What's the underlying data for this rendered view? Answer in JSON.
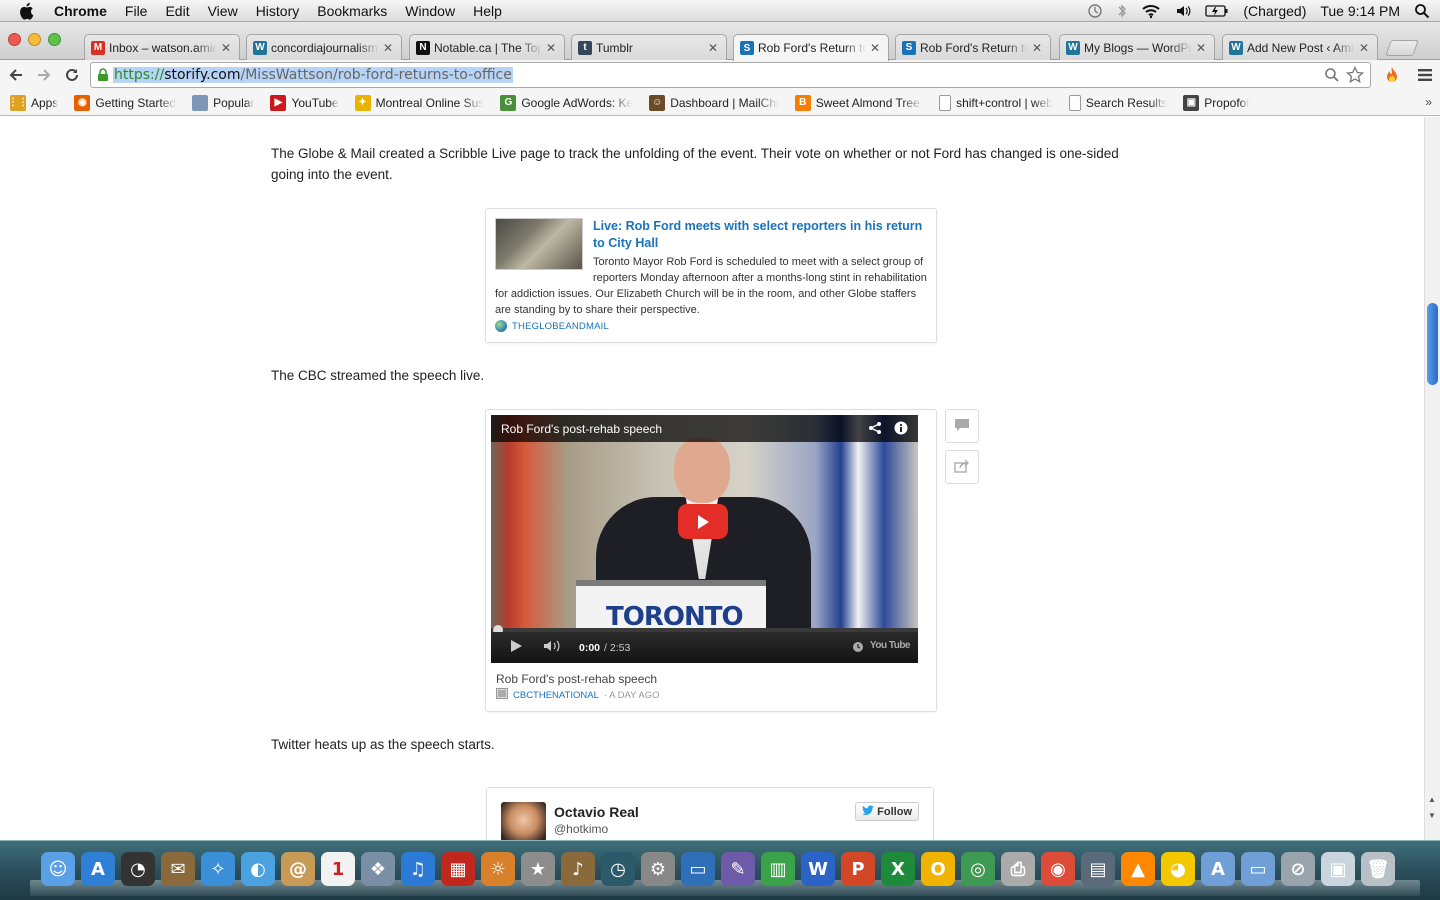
{
  "menubar": {
    "app_name": "Chrome",
    "menus": [
      "File",
      "Edit",
      "View",
      "History",
      "Bookmarks",
      "Window",
      "Help"
    ],
    "battery_status": "(Charged)",
    "clock": "Tue 9:14 PM"
  },
  "tabs": [
    {
      "title": "Inbox – watson.amie",
      "icon": "gmail-icon",
      "color": "#d93025",
      "glyph": "M"
    },
    {
      "title": "concordiajournalism",
      "icon": "wordpress-icon",
      "color": "#21759b",
      "glyph": "W"
    },
    {
      "title": "Notable.ca | The Top",
      "icon": "notable-icon",
      "color": "#111111",
      "glyph": "N"
    },
    {
      "title": "Tumblr",
      "icon": "tumblr-icon",
      "color": "#35465c",
      "glyph": "t"
    },
    {
      "title": "Rob Ford's Return to",
      "icon": "storify-icon",
      "color": "#1a73b8",
      "glyph": "S",
      "active": true
    },
    {
      "title": "Rob Ford's Return to",
      "icon": "storify-icon",
      "color": "#1a73b8",
      "glyph": "S"
    },
    {
      "title": "My Blogs — WordPre",
      "icon": "wordpress-icon",
      "color": "#21759b",
      "glyph": "W"
    },
    {
      "title": "Add New Post ‹ Amie",
      "icon": "wordpress-icon",
      "color": "#21759b",
      "glyph": "W"
    }
  ],
  "address": {
    "scheme": "https://",
    "host": "storify.com",
    "path": "/MissWattson/rob-ford-returns-to-office"
  },
  "bookmarks": [
    {
      "title": "Apps",
      "icon": "apps-grid-icon",
      "color": "#e0a020",
      "glyph": "⋮⋮"
    },
    {
      "title": "Getting Started",
      "icon": "firefox-icon",
      "color": "#e66000",
      "glyph": "◉"
    },
    {
      "title": "Popular",
      "icon": "folder-icon",
      "color": "#7d96b8",
      "glyph": ""
    },
    {
      "title": "YouTube",
      "icon": "youtube-icon",
      "color": "#cc181e",
      "glyph": "▶"
    },
    {
      "title": "Montreal Online Sus",
      "icon": "montreal-icon",
      "color": "#e8b400",
      "glyph": "✦"
    },
    {
      "title": "Google AdWords: Ke",
      "icon": "adwords-icon",
      "color": "#4a8f3a",
      "glyph": "G"
    },
    {
      "title": "Dashboard | MailChi",
      "icon": "mailchimp-icon",
      "color": "#6b4a2a",
      "glyph": "☺"
    },
    {
      "title": "Sweet Almond Tree:",
      "icon": "blogger-icon",
      "color": "#f57d00",
      "glyph": "B"
    },
    {
      "title": "shift+control | web",
      "icon": "page-icon",
      "color": "#ffffff",
      "glyph": ""
    },
    {
      "title": "Search Results",
      "icon": "page-icon",
      "color": "#ffffff",
      "glyph": ""
    },
    {
      "title": "Propofol",
      "icon": "propofol-icon",
      "color": "#444444",
      "glyph": "▣"
    }
  ],
  "story": {
    "para1": "The Globe & Mail created a Scribble Live page to track the unfolding of the event. Their vote on whether or not Ford has changed is one-sided going into the event.",
    "link_card": {
      "title": "Live: Rob Ford meets with select reporters in his return to City Hall",
      "description": "Toronto Mayor Rob Ford is scheduled to meet with a select group of reporters Monday afternoon after a months-long stint in rehabilitation for addiction issues. Our Elizabeth Church will be in the room, and other Globe staffers are standing by to share their perspective.",
      "source": "THEGLOBEANDMAIL"
    },
    "para2": "The CBC streamed the speech live.",
    "video": {
      "title": "Rob Ford's post-rehab speech",
      "time_current": "0:00",
      "time_total": "/ 2:53",
      "podium_text": "TORONTO",
      "caption": "Rob Ford's post-rehab speech",
      "source": "CBCTHENATIONAL",
      "ago": "· A DAY AGO",
      "youtube_label": "You Tube"
    },
    "para3": "Twitter heats up as the speech starts.",
    "tweet": {
      "name": "Octavio Real",
      "handle": "@hotkimo",
      "follow_label": "Follow"
    }
  },
  "dock": [
    {
      "name": "finder-icon",
      "color": "#5aa0e6",
      "glyph": "☺"
    },
    {
      "name": "app-store-icon",
      "color": "#2f7fd6",
      "glyph": "A"
    },
    {
      "name": "dashboard-icon",
      "color": "#333333",
      "glyph": "◔"
    },
    {
      "name": "mail-stamp-icon",
      "color": "#8a6a3a",
      "glyph": "✉"
    },
    {
      "name": "safari-icon",
      "color": "#3b8fd9",
      "glyph": "✧"
    },
    {
      "name": "facetime-icon",
      "color": "#4aa3e0",
      "glyph": "◐"
    },
    {
      "name": "contacts-icon",
      "color": "#c79a55",
      "glyph": "@"
    },
    {
      "name": "calendar-icon",
      "color": "#f2f2f2",
      "glyph": "1"
    },
    {
      "name": "photos-icon",
      "color": "#7a8fa6",
      "glyph": "❖"
    },
    {
      "name": "itunes-icon",
      "color": "#2a7ad6",
      "glyph": "♫"
    },
    {
      "name": "photo-booth-icon",
      "color": "#c0281e",
      "glyph": "▦"
    },
    {
      "name": "iphoto-icon",
      "color": "#d9802a",
      "glyph": "☼"
    },
    {
      "name": "imovie-icon",
      "color": "#8d8d8d",
      "glyph": "★"
    },
    {
      "name": "garageband-icon",
      "color": "#8a6a3a",
      "glyph": "♪"
    },
    {
      "name": "time-machine-icon",
      "color": "#2c5a6a",
      "glyph": "◷"
    },
    {
      "name": "system-preferences-icon",
      "color": "#888888",
      "glyph": "⚙"
    },
    {
      "name": "keynote-icon",
      "color": "#2e6fb8",
      "glyph": "▭"
    },
    {
      "name": "pages-icon",
      "color": "#6d5aa8",
      "glyph": "✎"
    },
    {
      "name": "numbers-icon",
      "color": "#3aa34a",
      "glyph": "▥"
    },
    {
      "name": "word-icon",
      "color": "#2b63c6",
      "glyph": "W"
    },
    {
      "name": "powerpoint-icon",
      "color": "#d24726",
      "glyph": "P"
    },
    {
      "name": "excel-icon",
      "color": "#1e8a3c",
      "glyph": "X"
    },
    {
      "name": "outlook-icon",
      "color": "#f0b400",
      "glyph": "O"
    },
    {
      "name": "network-globe-icon",
      "color": "#3e9a52",
      "glyph": "◎"
    },
    {
      "name": "printer-icon",
      "color": "#aaaaaa",
      "glyph": "⎙"
    },
    {
      "name": "chrome-icon",
      "color": "#dd4b39",
      "glyph": "◉"
    },
    {
      "name": "preview-icon",
      "color": "#5a6a7a",
      "glyph": "▤"
    },
    {
      "name": "vlc-icon",
      "color": "#ff8800",
      "glyph": "▲"
    },
    {
      "name": "cyberduck-icon",
      "color": "#f3c800",
      "glyph": "◕"
    },
    {
      "name": "applications-folder-icon",
      "color": "#6f9fd6",
      "glyph": "A"
    },
    {
      "name": "documents-folder-icon",
      "color": "#6f9fd6",
      "glyph": "▭"
    },
    {
      "name": "prohibited-icon",
      "color": "#9aa4ad",
      "glyph": "⊘"
    },
    {
      "name": "screenshot-icon",
      "color": "#c9d4dc",
      "glyph": "▣"
    },
    {
      "name": "trash-icon",
      "color": "#b8c0c6",
      "glyph": "🗑"
    }
  ]
}
